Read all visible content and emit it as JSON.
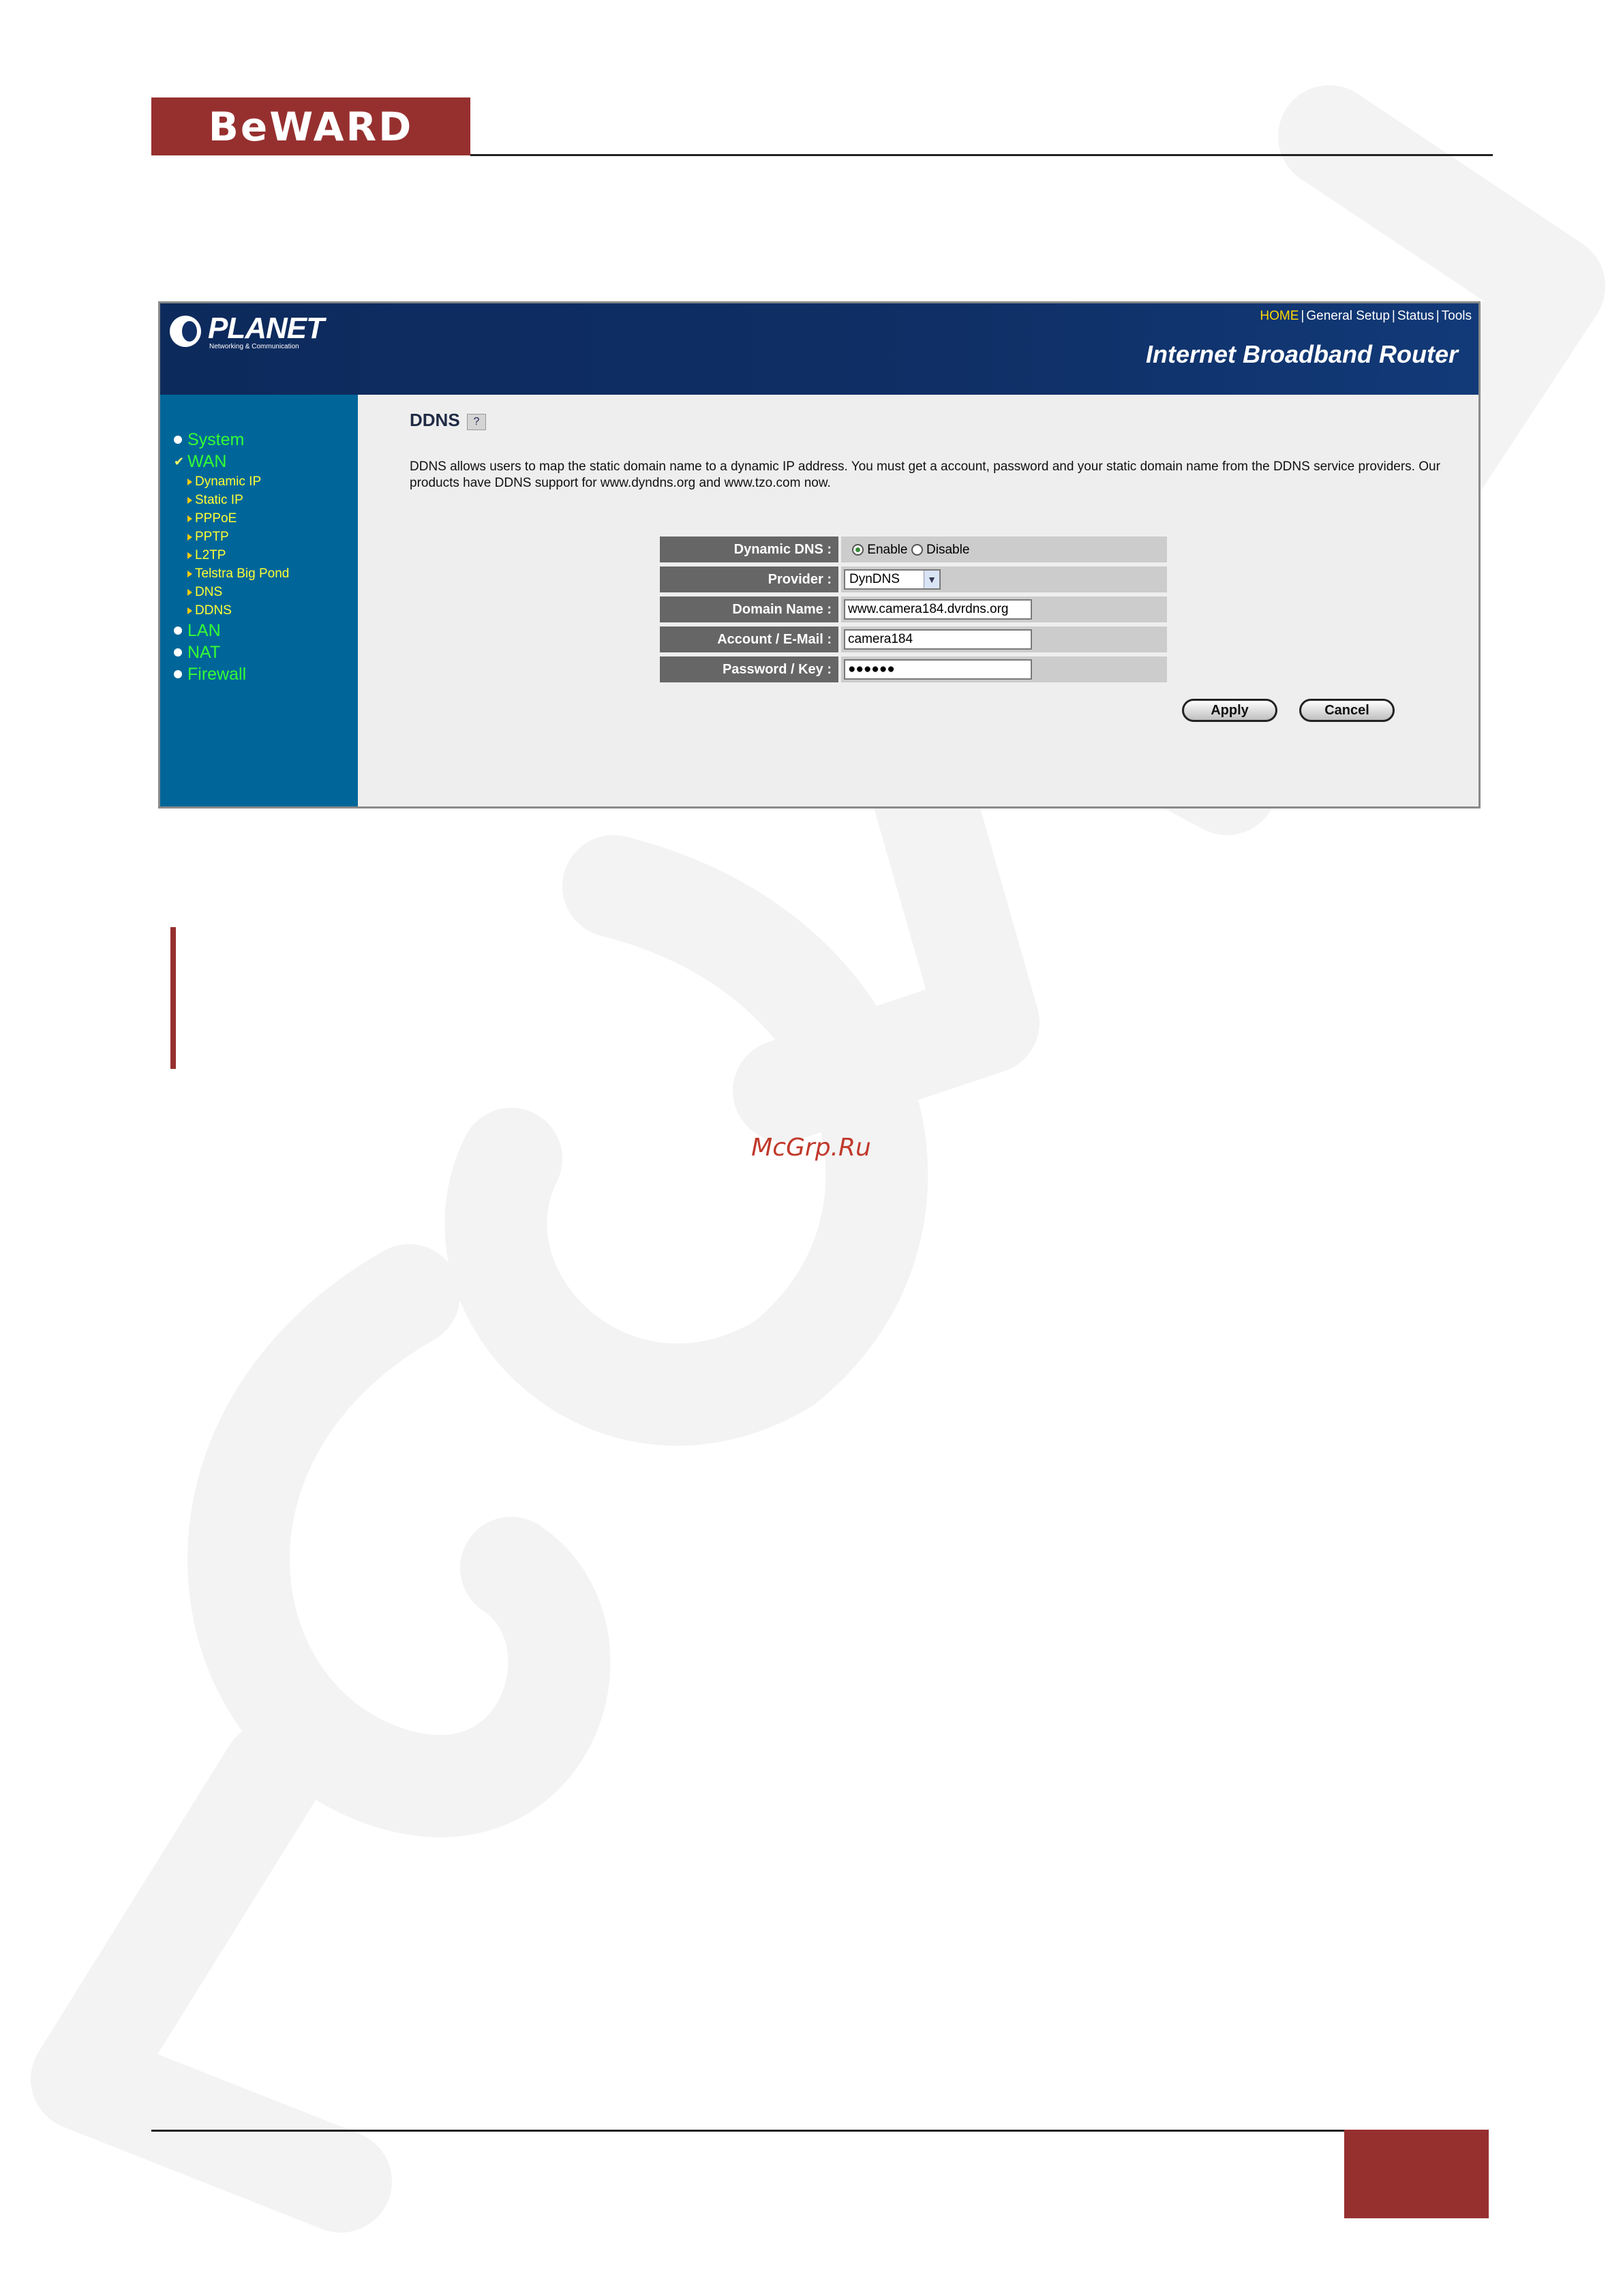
{
  "brand": {
    "logo_text": "BeWARD",
    "accent_color": "#96302f"
  },
  "router": {
    "vendor_logo": "PLANET",
    "vendor_tagline": "Networking & Communication",
    "product_title": "Internet Broadband Router",
    "top_nav": [
      "HOME",
      "General Setup",
      "Status",
      "Tools"
    ],
    "sidebar": {
      "main_items": [
        "System",
        "WAN",
        "LAN",
        "NAT",
        "Firewall"
      ],
      "wan_sub_items": [
        "Dynamic IP",
        "Static IP",
        "PPPoE",
        "PPTP",
        "L2TP",
        "Telstra Big Pond",
        "DNS",
        "DDNS"
      ]
    },
    "page": {
      "title": "DDNS",
      "description": "DDNS allows users to map the static domain name to a dynamic IP address. You must get a account, password and your static domain name from the DDNS service providers. Our products have DDNS support for www.dyndns.org and www.tzo.com now.",
      "fields": {
        "dynamic_dns_label": "Dynamic DNS :",
        "enable_label": "Enable",
        "disable_label": "Disable",
        "dynamic_dns_selected": "Enable",
        "provider_label": "Provider :",
        "provider_value": "DynDNS",
        "domain_label": "Domain Name :",
        "domain_value": "www.camera184.dvrdns.org",
        "account_label": "Account / E-Mail :",
        "account_value": "camera184",
        "password_label": "Password / Key :",
        "password_value": "●●●●●●"
      },
      "apply_label": "Apply",
      "cancel_label": "Cancel"
    }
  },
  "footer_watermark": "McGrp.Ru"
}
